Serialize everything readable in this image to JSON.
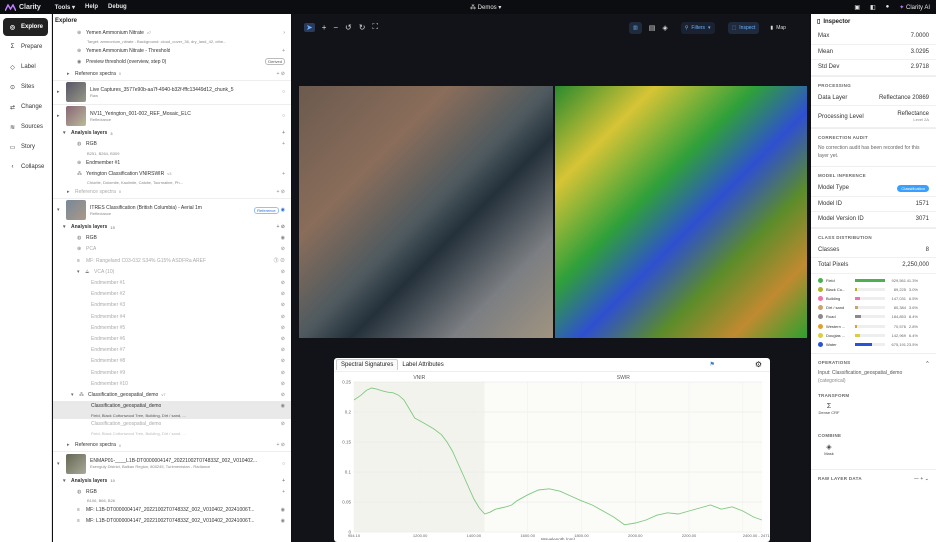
{
  "app": {
    "name": "Clarity",
    "menu": [
      "Tools ▾",
      "Help",
      "Debug"
    ],
    "workspace": "Demos",
    "assistant": "Clarity AI"
  },
  "nav": [
    "Explore",
    "Prepare",
    "Label",
    "Sites",
    "Change",
    "Sources",
    "Story",
    "Collapse"
  ],
  "explore": {
    "title": "Explore",
    "rows": [
      {
        "text": "Yemen Ammonium Nitrate",
        "tag": "v7",
        "indent": 20,
        "cls": "bold"
      },
      {
        "text": "Target: ammonium_nitrate - Background: cloud_cover_36, dry_land_42, othe...",
        "indent": 30,
        "cls": "small"
      },
      {
        "text": "Yemen Ammonium Nitrate - Threshold",
        "indent": 30
      },
      {
        "text": "Preview threshold (overview, step 0)",
        "indent": 30,
        "badge": "Derived"
      },
      {
        "text": "Reference spectra",
        "tag": "0",
        "indent": 14,
        "cls": "gray"
      }
    ],
    "captures": [
      {
        "name": "Live Captures_3577e90b-aa7f-4940-b32f-fffc13449d12_chunk_5",
        "sub": "Raw"
      },
      {
        "name": "NV11_Yerington_001-002_REF_Mosaic_ELC",
        "sub": "Reflectance"
      }
    ],
    "yerington_layers": {
      "label": "Analysis layers",
      "count": "3",
      "items": [
        {
          "name": "RGB",
          "sub": "B251, B264, B309"
        },
        {
          "name": "Endmember #1"
        },
        {
          "name": "Yerington Classification VNIRSWIR",
          "tag": "v3",
          "sub": "Chlorite, Dolomite, Kaolinite, Calcite, Tourmaline, Ph..."
        }
      ]
    },
    "ref_spectra_2": "Reference spectra",
    "ref_spectra_2_count": "0",
    "itres": {
      "name": "ITRES Classification (British Columbia) - Aerial 1m",
      "sub": "Reflectance",
      "badge": "Reference"
    },
    "itres_layers": {
      "label": "Analysis layers",
      "count": "15",
      "items": [
        "RGB",
        "PCA",
        "MF: Rangeland C03-032 S34% G15% ASDFRa AREF"
      ],
      "vca": "VCA (10)",
      "endmembers": [
        "Endmember #1",
        "Endmember #2",
        "Endmember #3",
        "Endmember #4",
        "Endmember #5",
        "Endmember #6",
        "Endmember #7",
        "Endmember #8",
        "Endmember #9",
        "Endmember #10"
      ],
      "classif": "Classification_geospatial_demo",
      "classif_tag": "v7",
      "selected": "Classification_geospatial_demo",
      "selected_sub": "Field, Black Cottonwood Tree, Building, Dirt / sand, ...",
      "derived": "Classification_geospatial_demo",
      "derived_sub": "Field, Black Cottonwood Tree, Building, Dirt / sand, ..."
    },
    "ref_spectra_3": "Reference spectra",
    "ref_spectra_3_count": "0",
    "enmap": {
      "name": "ENMAP01-____L1B-DT0000004147_20221002T074833Z_002_V010402...",
      "sub": "Esenguly District, Balkan Region, 800245, Turkmenistan - Radiance"
    },
    "enmap_layers": {
      "label": "Analysis layers",
      "count": "10",
      "items": [
        {
          "name": "RGB",
          "sub": "B106, B66, B26"
        },
        {
          "name": "MF: L1B-DT0000004147_20221002T074833Z_002_V010402_20241006T..."
        },
        {
          "name": "MF: L1B-DT0000004147_20221002T074833Z_002_V010402_20241006T..."
        }
      ]
    }
  },
  "toolbar": {
    "filters": "Filters",
    "inspect": "Inspect",
    "map": "Map"
  },
  "chart_tabs": [
    "Spectral Signatures",
    "Label Attributes"
  ],
  "chart_data": {
    "type": "line",
    "xlabel": "Wavelength (nm)",
    "xlim": [
      954.1,
      2471.3
    ],
    "xticks": [
      954.1,
      1200.0,
      1400.0,
      1600.0,
      1800.0,
      2000.0,
      2200.0,
      2400.0
    ],
    "xtick_labels": [
      "954.10",
      "1200.00",
      "1400.00",
      "1600.00",
      "1800.00",
      "2000.00",
      "2200.00",
      "2400.00 - 2471.30"
    ],
    "ylim": [
      0,
      0.25
    ],
    "yticks": [
      0,
      0.05,
      0.1,
      0.15,
      0.2,
      0.25
    ],
    "ytick_labels": [
      "0",
      "0.05",
      "0.1",
      "0.15",
      "0.2",
      "0.25"
    ],
    "regions": [
      {
        "label": "VNIR",
        "from": 954.1,
        "to": 1440
      },
      {
        "label": "SWIR",
        "from": 1440,
        "to": 2471.3
      }
    ],
    "series": [
      {
        "color": "#7fc97f",
        "x": [
          954,
          980,
          1000,
          1020,
          1040,
          1060,
          1080,
          1100,
          1120,
          1140,
          1160,
          1180,
          1200,
          1220,
          1250,
          1280,
          1300,
          1320,
          1340,
          1360,
          1380,
          1400,
          1420,
          1440,
          1460,
          1480,
          1500,
          1520,
          1540,
          1560,
          1600,
          1640,
          1680,
          1720,
          1760,
          1800,
          1840,
          1880,
          1920,
          1960,
          2000,
          2040,
          2080,
          2120,
          2160,
          2200,
          2240,
          2280,
          2320,
          2360,
          2400,
          2440,
          2471
        ],
        "y": [
          0.22,
          0.228,
          0.236,
          0.24,
          0.238,
          0.235,
          0.233,
          0.232,
          0.228,
          0.22,
          0.205,
          0.19,
          0.185,
          0.18,
          0.172,
          0.162,
          0.15,
          0.135,
          0.115,
          0.095,
          0.075,
          0.055,
          0.04,
          0.03,
          0.033,
          0.038,
          0.04,
          0.042,
          0.045,
          0.052,
          0.062,
          0.07,
          0.072,
          0.068,
          0.06,
          0.052,
          0.045,
          0.035,
          0.025,
          0.012,
          0.015,
          0.02,
          0.028,
          0.032,
          0.03,
          0.035,
          0.04,
          0.045,
          0.038,
          0.042,
          0.035,
          0.025,
          0.02
        ]
      }
    ]
  },
  "inspector": {
    "title": "Inspector",
    "stats": [
      {
        "k": "Max",
        "v": "7.0000"
      },
      {
        "k": "Mean",
        "v": "3.0295"
      },
      {
        "k": "Std Dev",
        "v": "2.9718"
      }
    ],
    "processing_title": "PROCESSING",
    "processing": [
      {
        "k": "Data Layer",
        "v": "Reflectance 20869"
      },
      {
        "k": "Processing Level",
        "v": "Reflectance",
        "sub": "Level 2A"
      }
    ],
    "audit_title": "CORRECTION AUDIT",
    "audit_text": "No correction audit has been recorded for this layer yet.",
    "model_title": "MODEL INFERENCE",
    "model": [
      {
        "k": "Model Type",
        "v": "Classification"
      },
      {
        "k": "Model ID",
        "v": "1571"
      },
      {
        "k": "Model Version ID",
        "v": "3071"
      }
    ],
    "class_title": "CLASS DISTRIBUTION",
    "class_summary": [
      {
        "k": "Classes",
        "v": "8"
      },
      {
        "k": "Total Pixels",
        "v": "2,250,000"
      }
    ],
    "classes": [
      {
        "name": "Field",
        "color": "#4caf50",
        "count": "929,561",
        "pct": "41.3%",
        "frac": 0.413
      },
      {
        "name": "Black Co...",
        "color": "#b0b22a",
        "count": "89,225",
        "pct": "3.0%",
        "frac": 0.03
      },
      {
        "name": "Building",
        "color": "#f26fb0",
        "count": "147,031",
        "pct": "6.5%",
        "frac": 0.065
      },
      {
        "name": "Dirt / sand",
        "color": "#c9a46b",
        "count": "80,384",
        "pct": "3.6%",
        "frac": 0.036
      },
      {
        "name": "Road",
        "color": "#8a8a8a",
        "count": "184,853",
        "pct": "8.4%",
        "frac": 0.084
      },
      {
        "name": "Western ...",
        "color": "#e0a030",
        "count": "70,576",
        "pct": "2.8%",
        "frac": 0.028
      },
      {
        "name": "Douglas ...",
        "color": "#d8d040",
        "count": "142,969",
        "pct": "6.4%",
        "frac": 0.064
      },
      {
        "name": "Water",
        "color": "#2a52d6",
        "count": "675,191",
        "pct": "23.5%",
        "frac": 0.235
      }
    ],
    "ops_title": "OPERATIONS",
    "ops_input": "Input: Classification_geospatial_demo",
    "ops_input_sub": "(categorical)",
    "transform_title": "TRANSFORM",
    "transform_btn": "Dense CRF",
    "combine_title": "COMBINE",
    "combine_btn": "Mask",
    "raw_title": "RAW LAYER DATA"
  }
}
